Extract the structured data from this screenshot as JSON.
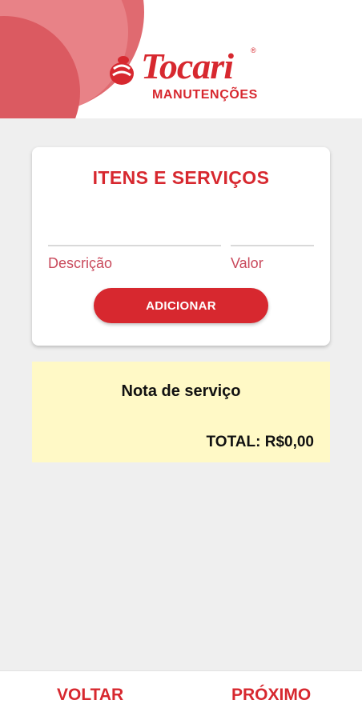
{
  "brand": {
    "name": "Tocari",
    "registered_mark": "®",
    "subtitle": "MANUTENÇÕES",
    "color": "#d7282f"
  },
  "items_card": {
    "title": "ITENS E SERVIÇOS",
    "description_label": "Descrição",
    "description_value": "",
    "value_label": "Valor",
    "value_value": "",
    "add_button_label": "ADICIONAR"
  },
  "service_note": {
    "title": "Nota de serviço",
    "total": "TOTAL: R$0,00",
    "background": "#fff9c6"
  },
  "bottom_nav": {
    "back_label": "VOLTAR",
    "next_label": "PRÓXIMO"
  }
}
